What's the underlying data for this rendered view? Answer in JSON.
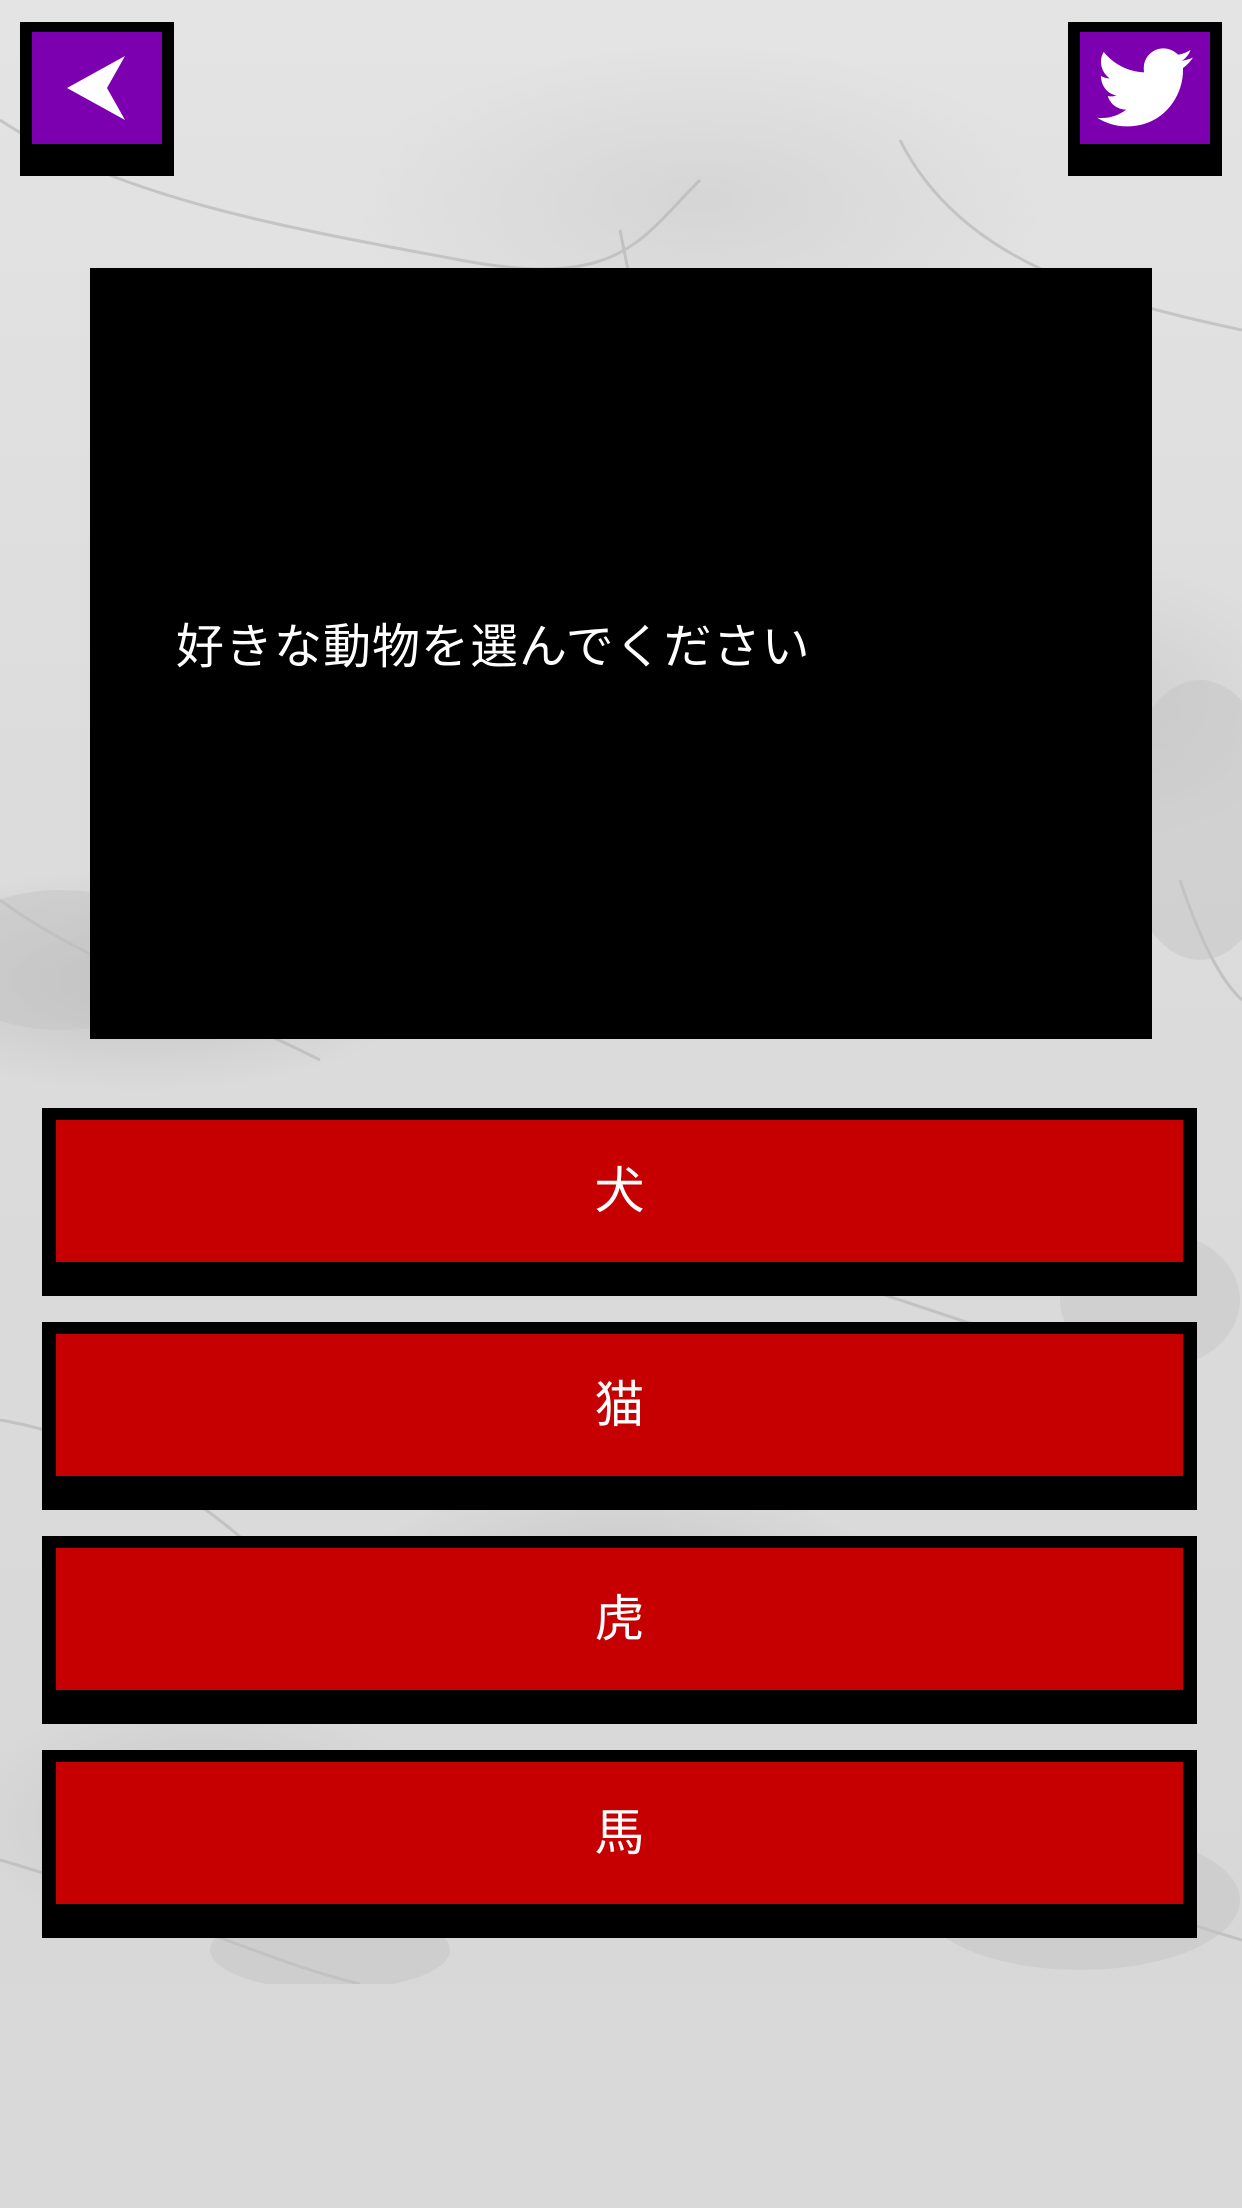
{
  "colors": {
    "accent_purple": "#7d00b0",
    "answer_red": "#c60000",
    "panel_black": "#000000",
    "background_gray": "#d9d9d9"
  },
  "header": {
    "back_icon": "back-arrow-icon",
    "share_icon": "twitter-bird-icon"
  },
  "question": {
    "text": "好きな動物を選んでください"
  },
  "answers": [
    {
      "label": "犬"
    },
    {
      "label": "猫"
    },
    {
      "label": "虎"
    },
    {
      "label": "馬"
    }
  ]
}
